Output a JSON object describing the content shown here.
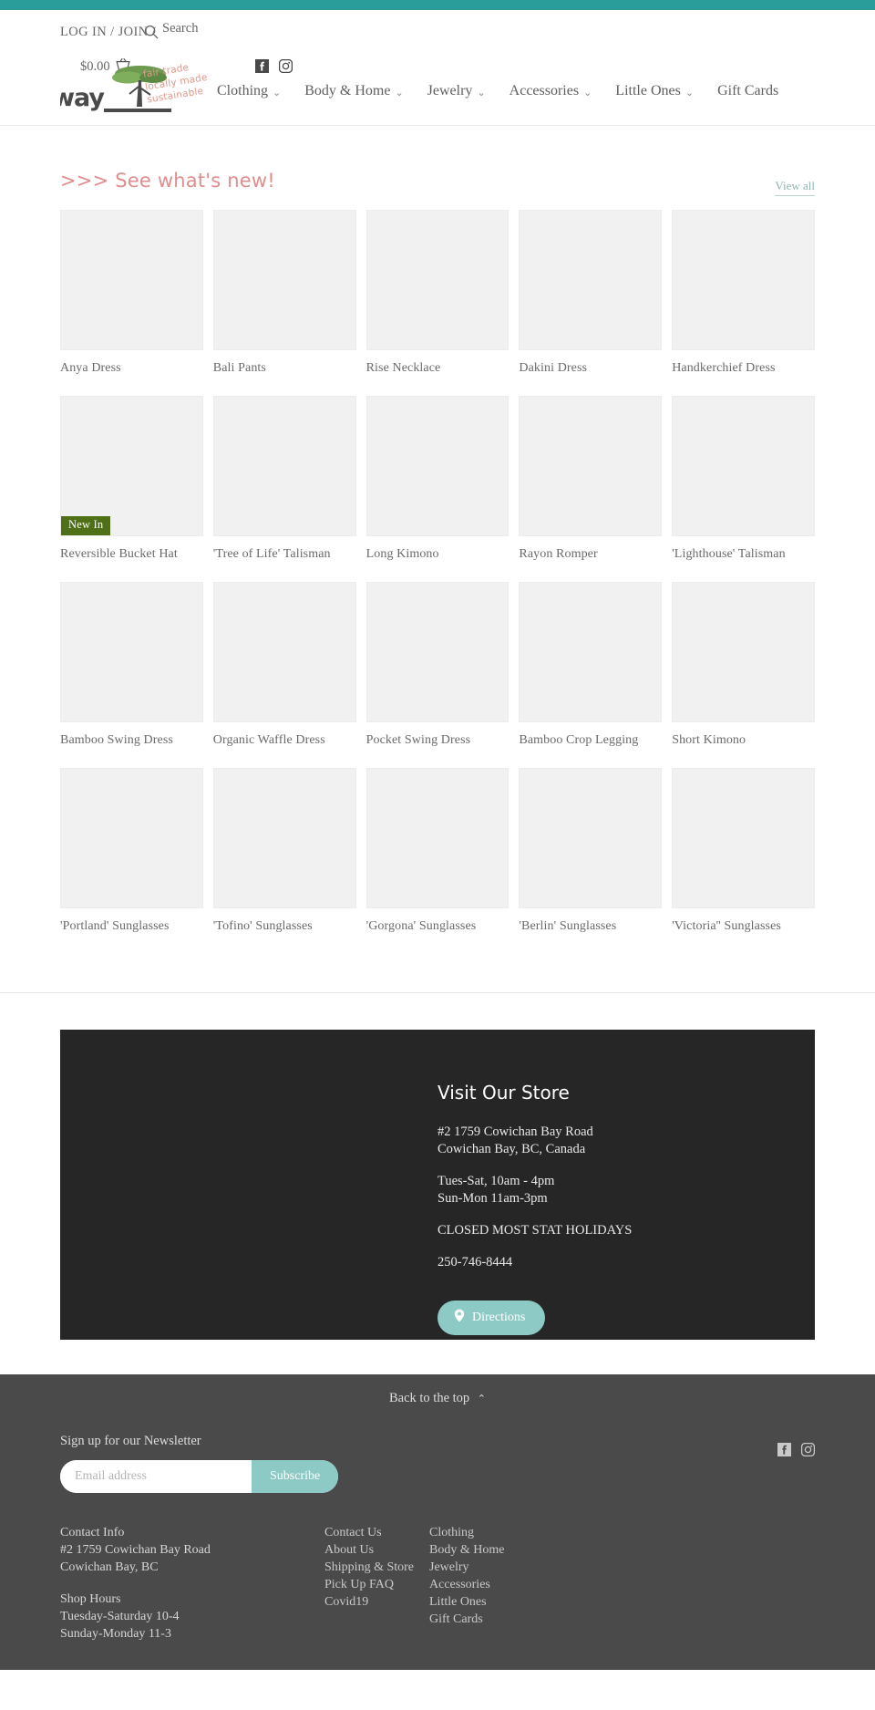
{
  "theme": {
    "top_strip": "#2a9d9b",
    "accent_pink": "#e08d8d",
    "accent_teal": "#8ecac5",
    "badge_green": "#4f7017",
    "panel_dark": "#262626",
    "footer_dark": "#4a4a4a"
  },
  "utility": {
    "login_label": "LOG IN / JOIN /",
    "search_label": "Search",
    "search_icon": "search-icon",
    "cart_total": "$0.00",
    "cart_icon": "shopping-basket-icon",
    "social": [
      {
        "name": "facebook-icon",
        "label": "Facebook"
      },
      {
        "name": "instagram-icon",
        "label": "Instagram"
      }
    ]
  },
  "brand": {
    "logo_text": "radway",
    "tagline_line1": "fair trade",
    "tagline_line2": "locally made",
    "tagline_line3": "sustainable"
  },
  "nav": {
    "items": [
      {
        "label": "Clothing",
        "has_dropdown": true
      },
      {
        "label": "Body & Home",
        "has_dropdown": true
      },
      {
        "label": "Jewelry",
        "has_dropdown": true
      },
      {
        "label": "Accessories",
        "has_dropdown": true
      },
      {
        "label": "Little Ones",
        "has_dropdown": true
      },
      {
        "label": "Gift Cards",
        "has_dropdown": false
      }
    ],
    "caret_glyph": "⌄"
  },
  "section": {
    "title": ">>> See what's new!",
    "view_all_label": "View all"
  },
  "products": [
    {
      "title": "Anya Dress",
      "badge": null
    },
    {
      "title": "Bali Pants",
      "badge": null
    },
    {
      "title": "Rise Necklace",
      "badge": null
    },
    {
      "title": "Dakini Dress",
      "badge": null
    },
    {
      "title": "Handkerchief Dress",
      "badge": null
    },
    {
      "title": "Reversible Bucket Hat",
      "badge": "New In"
    },
    {
      "title": "'Tree of Life' Talisman",
      "badge": null
    },
    {
      "title": "Long Kimono",
      "badge": null
    },
    {
      "title": "Rayon Romper",
      "badge": null
    },
    {
      "title": "'Lighthouse' Talisman",
      "badge": null
    },
    {
      "title": "Bamboo Swing Dress",
      "badge": null
    },
    {
      "title": "Organic Waffle Dress",
      "badge": null
    },
    {
      "title": "Pocket Swing Dress",
      "badge": null
    },
    {
      "title": "Bamboo Crop Legging",
      "badge": null
    },
    {
      "title": "Short Kimono",
      "badge": null
    },
    {
      "title": "'Portland' Sunglasses",
      "badge": null
    },
    {
      "title": "'Tofino' Sunglasses",
      "badge": null
    },
    {
      "title": "'Gorgona' Sunglasses",
      "badge": null
    },
    {
      "title": "'Berlin' Sunglasses",
      "badge": null
    },
    {
      "title": "'Victoria'' Sunglasses",
      "badge": null
    }
  ],
  "store": {
    "heading": "Visit Our Store",
    "address_line1": "#2 1759 Cowichan Bay Road",
    "address_line2": "Cowichan Bay, BC, Canada",
    "hours_line1": "Tues-Sat, 10am - 4pm",
    "hours_line2": "Sun-Mon 11am-3pm",
    "holidays": "CLOSED MOST STAT HOLIDAYS",
    "phone": "250-746-8444",
    "directions_label": "Directions",
    "directions_icon": "map-pin-icon"
  },
  "footer": {
    "back_to_top": "Back to the top",
    "back_to_top_icon": "chevron-up-icon",
    "newsletter_label": "Sign up for our Newsletter",
    "email_placeholder": "Email address",
    "email_value": "",
    "subscribe_label": "Subscribe",
    "social": [
      {
        "name": "facebook-icon",
        "label": "Facebook"
      },
      {
        "name": "instagram-icon",
        "label": "Instagram"
      }
    ],
    "col1": {
      "contact_head": "Contact Info",
      "contact_line1": "#2 1759 Cowichan Bay Road",
      "contact_line2": "Cowichan Bay, BC",
      "hours_head": "Shop Hours",
      "hours_line1": "Tuesday-Saturday 10-4",
      "hours_line2": "Sunday-Monday 11-3"
    },
    "col2": [
      "Contact Us",
      "About Us",
      "Shipping & Store Pick Up FAQ",
      "Covid19"
    ],
    "col3": [
      "Clothing",
      "Body & Home",
      "Jewelry",
      "Accessories",
      "Little Ones",
      "Gift Cards"
    ]
  }
}
